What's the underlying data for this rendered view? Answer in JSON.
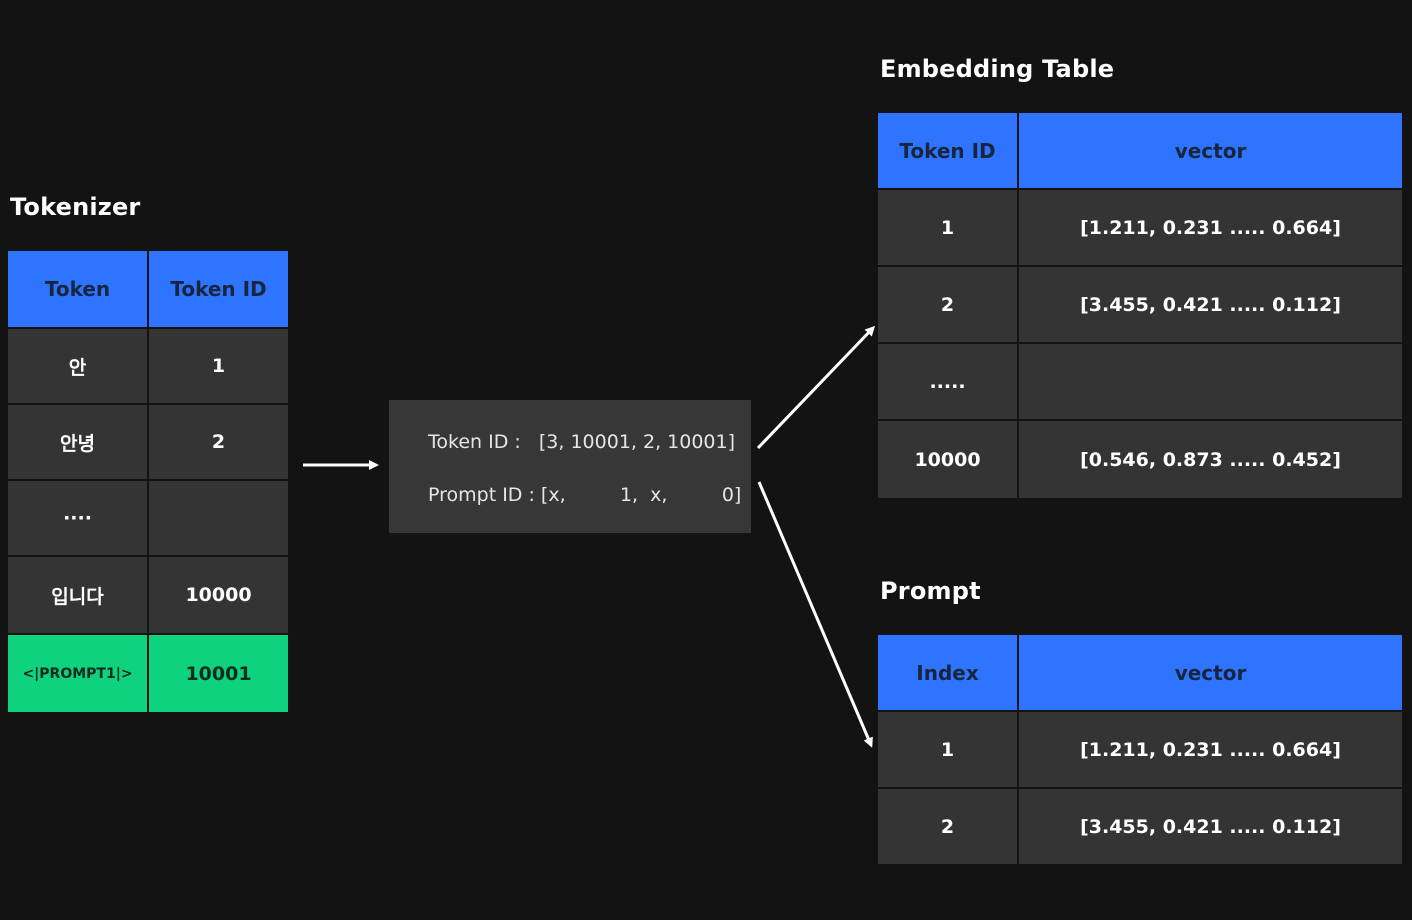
{
  "tokenizer": {
    "title": "Tokenizer",
    "headers": [
      "Token",
      "Token ID"
    ],
    "rows": [
      {
        "token": "안",
        "id": "1"
      },
      {
        "token": "안녕",
        "id": "2"
      },
      {
        "token": "····",
        "id": ""
      },
      {
        "token": "입니다",
        "id": "10000"
      },
      {
        "token": "<|PROMPT1|>",
        "id": "10001"
      }
    ]
  },
  "middle": {
    "token_id_line": "Token ID :   [3, 10001, 2, 10001]",
    "prompt_id_line": "Prompt ID : [x,         1,  x,         0]"
  },
  "embedding_table": {
    "title": "Embedding Table",
    "headers": [
      "Token ID",
      "vector"
    ],
    "rows": [
      {
        "id": "1",
        "vector": "[1.211, 0.231 ..... 0.664]"
      },
      {
        "id": "2",
        "vector": "[3.455, 0.421 ..... 0.112]"
      },
      {
        "id": ".....",
        "vector": ""
      },
      {
        "id": "10000",
        "vector": "[0.546, 0.873 ..... 0.452]"
      }
    ]
  },
  "prompt": {
    "title": "Prompt",
    "headers": [
      "Index",
      "vector"
    ],
    "rows": [
      {
        "id": "1",
        "vector": "[1.211, 0.231 ..... 0.664]"
      },
      {
        "id": "2",
        "vector": "[3.455, 0.421 ..... 0.112]"
      }
    ]
  },
  "colors": {
    "background": "#131313",
    "header_blue": "#2f74ff",
    "cell_gray": "#343434",
    "highlight_green": "#0ed27d",
    "arrow": "#ffffff"
  }
}
